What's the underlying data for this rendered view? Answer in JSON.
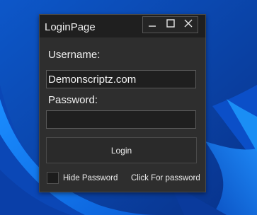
{
  "window": {
    "title": "LoginPage",
    "controls": {
      "minimize": "minimize-icon",
      "maximize": "maximize-icon",
      "close": "close-icon"
    }
  },
  "form": {
    "username_label": "Username:",
    "username_value": "Demonscriptz.com",
    "password_label": "Password:",
    "password_value": "",
    "login_button": "Login",
    "hide_password_label": "Hide Password",
    "click_for_password": "Click For password",
    "hide_password_checked": false
  },
  "colors": {
    "window_bg": "#2e2e2e",
    "titlebar_bg": "#1f1f1f",
    "field_bg": "#1f1f1f",
    "text": "#f2f2f2",
    "desktop_blue": "#0a3f9f"
  }
}
